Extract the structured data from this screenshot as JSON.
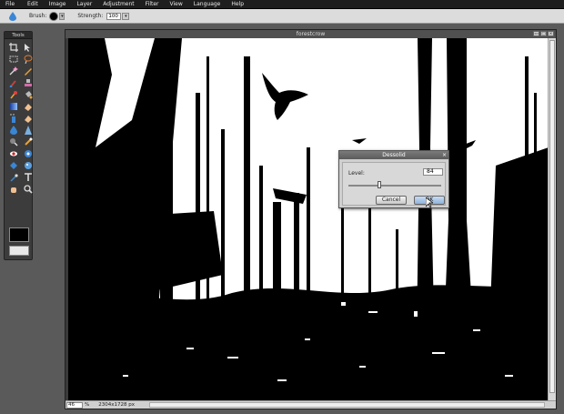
{
  "menubar": {
    "items": [
      "File",
      "Edit",
      "Image",
      "Layer",
      "Adjustment",
      "Filter",
      "View",
      "Language",
      "Help"
    ]
  },
  "options": {
    "brush_label": "Brush:",
    "strength_label": "Strength:",
    "strength_value": "100"
  },
  "tools": {
    "title": "Tools",
    "icons": [
      "crop-icon",
      "move-icon",
      "marquee-select-icon",
      "lasso-icon",
      "magic-wand-icon",
      "pencil-icon",
      "brush-icon",
      "clone-stamp-icon",
      "color-replace-icon",
      "paint-bucket-icon",
      "gradient-icon",
      "eraser-icon",
      "spray-icon",
      "eraser-icon",
      "drop-icon",
      "sharpen-icon",
      "burn-icon",
      "dodge-icon",
      "red-eye-icon",
      "pinch-icon",
      "bloat-icon",
      "sponge-icon",
      "color-picker-icon",
      "type-icon",
      "hand-icon",
      "zoom-icon"
    ]
  },
  "document": {
    "title": "forestcrow",
    "zoom_value": "46",
    "zoom_unit": "%",
    "dimensions": "2304x1728 px"
  },
  "dialog": {
    "title": "Dessolid",
    "level_label": "Level:",
    "level_value": "84",
    "slider_value": 84,
    "cancel_label": "Cancel",
    "ok_label": "OK",
    "close_glyph": "×"
  },
  "window_buttons": [
    "▭",
    "□",
    "×"
  ]
}
